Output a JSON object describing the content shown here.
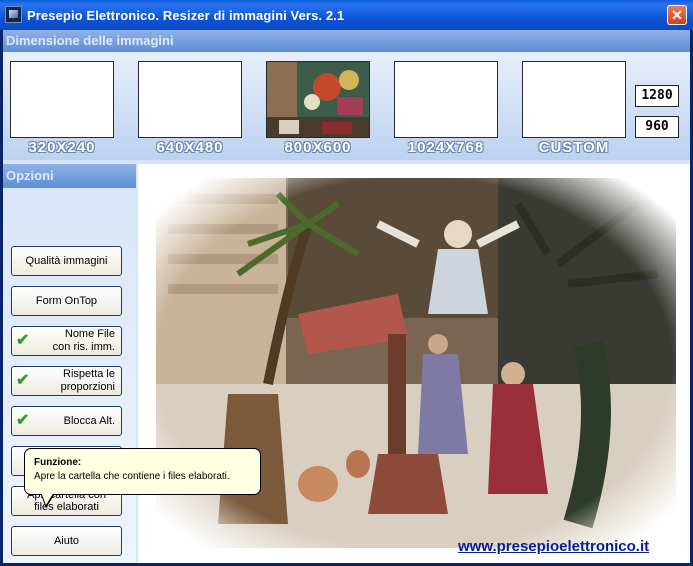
{
  "window": {
    "title": "Presepio Elettronico. Resizer di immagini  Vers. 2.1",
    "close_symbol": "✕"
  },
  "dimensions": {
    "header": "Dimensione delle immagini",
    "thumbnails": [
      {
        "label": "320X240",
        "selected": false
      },
      {
        "label": "640X480",
        "selected": false
      },
      {
        "label": "800X600",
        "selected": true
      },
      {
        "label": "1024X768",
        "selected": false
      },
      {
        "label": "CUSTOM",
        "selected": false
      }
    ],
    "custom_width": "1280",
    "custom_height": "960"
  },
  "options": {
    "header": "Opzioni",
    "buttons": {
      "quality": "Qualità immagini",
      "ontop": "Form OnTop",
      "filename": "Nome File\ncon ris. imm.",
      "proportions": "Rispetta le\nproporzioni",
      "lock_height": "Blocca Alt.",
      "open_folder": "Apri cartella con\nfiles elaborati",
      "help": "Aiuto"
    },
    "checked": {
      "filename": true,
      "proportions": true,
      "lock_height": true
    },
    "check_icon": "check-icon"
  },
  "tooltip": {
    "title": "Funzione:",
    "text": "Apre la cartella che contiene i files elaborati."
  },
  "preview": {
    "url": "www.presepioelettronico.it"
  },
  "colors": {
    "title_bar": "#0c55d6",
    "panel_header": "#5e8ed6",
    "check": "#2fa32f",
    "url": "#0a1f8f"
  }
}
